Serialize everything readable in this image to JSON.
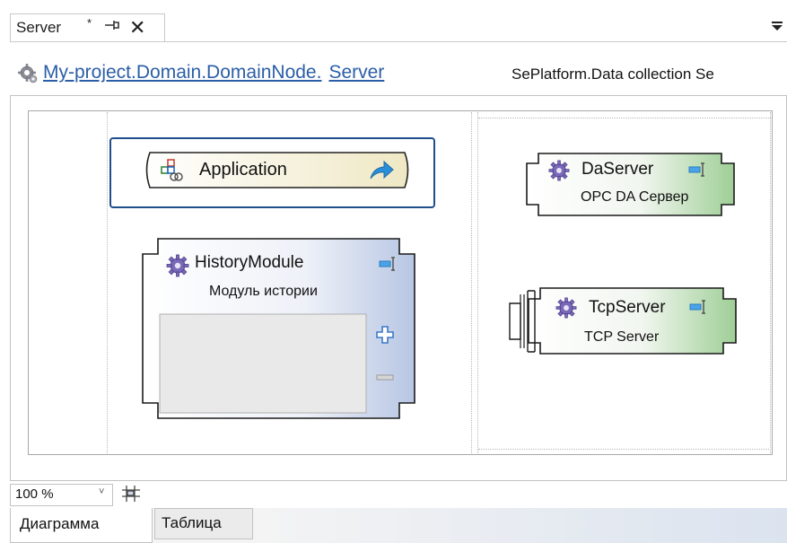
{
  "tab": {
    "title": "Server",
    "modified_mark": "*",
    "pin_glyph": "⊣",
    "close_glyph": "✕"
  },
  "breadcrumb": {
    "icon": "gear-icon",
    "segments": [
      "My-project.Domain.DomainNode.",
      "Server"
    ],
    "type_text": "SePlatform.Data collection Se"
  },
  "diagram": {
    "application": {
      "label": "Application",
      "icon": "application-icon",
      "go_icon": "arrow-icon"
    },
    "nodes": [
      {
        "id": "history",
        "label": "HistoryModule",
        "sublabel": "Модуль истории"
      },
      {
        "id": "da",
        "label": "DaServer",
        "sublabel": "OPC DA Сервер"
      },
      {
        "id": "tcp",
        "label": "TcpServer",
        "sublabel": "TCP Server"
      }
    ],
    "add_glyph": "+",
    "remove_glyph": "−"
  },
  "zoom": {
    "value": "100 %",
    "arrow": "˅"
  },
  "bottom_tabs": [
    {
      "label": "Диаграмма",
      "active": true
    },
    {
      "label": "Таблица",
      "active": false
    }
  ],
  "colors": {
    "link": "#2b5ea7",
    "selection": "#1f4e8c",
    "history_fill_end": "#b7c6e3",
    "server_fill_end": "#9fcf97"
  }
}
